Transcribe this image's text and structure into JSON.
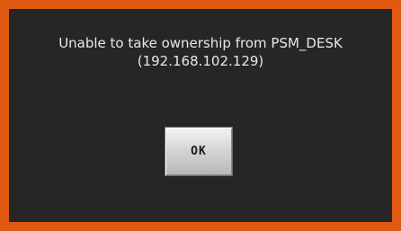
{
  "dialog": {
    "message_line1": "Unable to take ownership from PSM_DESK",
    "message_line2": "(192.168.102.129)",
    "ok_label": "OK"
  },
  "colors": {
    "border": "#e05a12",
    "background": "#262626",
    "text": "#e8e8e8"
  }
}
